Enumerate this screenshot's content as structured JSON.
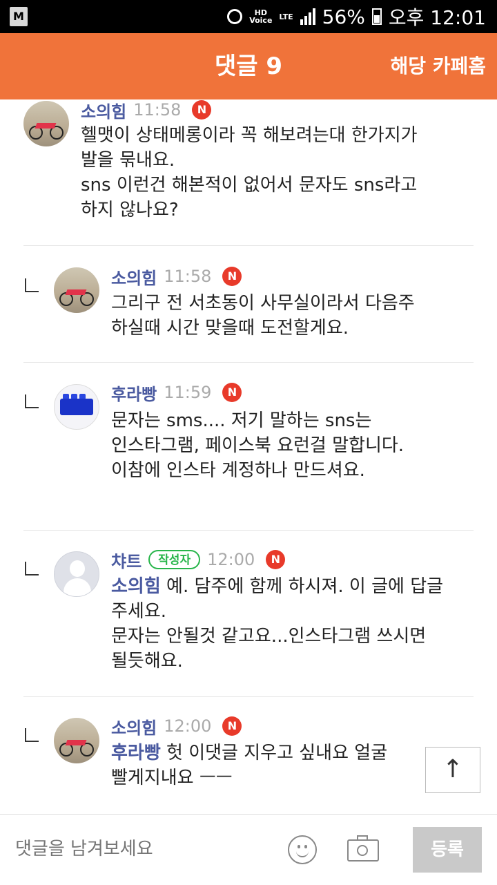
{
  "status_bar": {
    "app_icon": "M",
    "hd_voice": "HD\nVoice",
    "network": "LTE",
    "battery_percent": "56%",
    "time": "오후 12:01"
  },
  "header": {
    "title": "댓글 9",
    "cafe_home": "해당 카페홈"
  },
  "comments": [
    {
      "nickname": "소의힘",
      "time": "11:58",
      "new_badge": "N",
      "text": "헬맷이 상태메롱이라 꼭 해보려는대 한가지가\n발을 묶내요.\nsns 이런건 해본적이 없어서 문자도 sns라고\n하지 않나요?",
      "avatar": "bike"
    },
    {
      "nickname": "소의힘",
      "time": "11:58",
      "new_badge": "N",
      "text": "그리구 전 서초동이 사무실이라서 다음주\n하실때 시간 맞을때 도전할게요.",
      "avatar": "bike"
    },
    {
      "nickname": "후라빵",
      "time": "11:59",
      "new_badge": "N",
      "text": "문자는 sms.... 저기 말하는 sns는\n인스타그램, 페이스북 요런걸 말합니다.\n이참에 인스타 계정하나 만드셔요.",
      "avatar": "lego"
    },
    {
      "nickname": "챠트",
      "author_badge": "작성자",
      "time": "12:00",
      "new_badge": "N",
      "mention": "소의힘",
      "text_line1": " 예. 담주에 함께 하시져. 이 글에 답글",
      "text_rest": "주세요.\n문자는 안될것 같고요...인스타그램 쓰시면\n될듯해요.",
      "avatar": "default"
    },
    {
      "nickname": "소의힘",
      "time": "12:00",
      "new_badge": "N",
      "mention": "후라빵",
      "text_line1": " 헛 이댓글 지우고 싶내요 얼굴",
      "text_rest": "빨게지내요 ㅡㅡ",
      "avatar": "bike"
    }
  ],
  "scroll_top": {
    "icon": "arrow-up-icon",
    "glyph": "↑"
  },
  "input_bar": {
    "placeholder": "댓글을 남겨보세요",
    "submit_label": "등록"
  },
  "colors": {
    "header_bg": "#f0733a",
    "nickname": "#4a5aa0",
    "new_badge": "#e83a2a",
    "author_badge": "#27b54a"
  }
}
